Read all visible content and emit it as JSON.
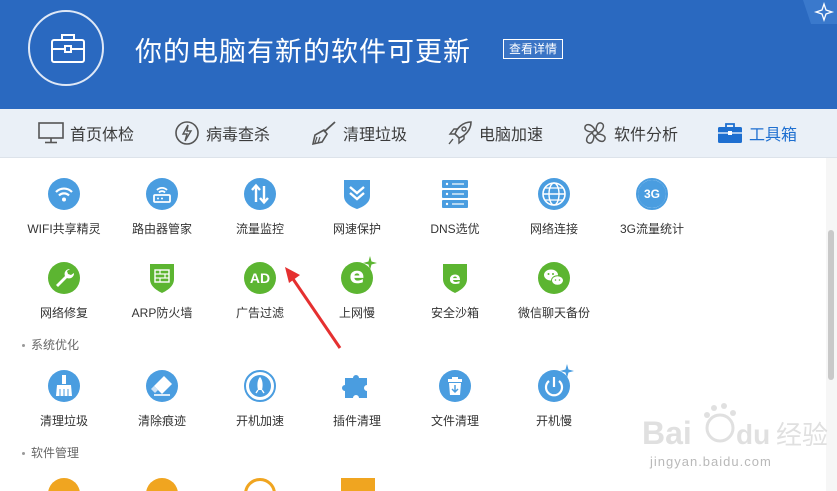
{
  "header": {
    "title": "你的电脑有新的软件可更新",
    "detail_button": "查看详情",
    "bg_color": "#2a69c0"
  },
  "nav": {
    "items": [
      {
        "label": "首页体检",
        "icon": "monitor-icon"
      },
      {
        "label": "病毒查杀",
        "icon": "lightning-shield-icon"
      },
      {
        "label": "清理垃圾",
        "icon": "broom-icon"
      },
      {
        "label": "电脑加速",
        "icon": "rocket-icon"
      },
      {
        "label": "软件分析",
        "icon": "fan-icon"
      },
      {
        "label": "工具箱",
        "icon": "toolbox-icon",
        "active": true
      }
    ],
    "active_color": "#1e6fd0"
  },
  "sections": {
    "network_row1": [
      {
        "label": "WIFI共享精灵",
        "icon": "wifi-icon",
        "color": "#4a9de0"
      },
      {
        "label": "路由器管家",
        "icon": "router-icon",
        "color": "#4a9de0"
      },
      {
        "label": "流量监控",
        "icon": "updown-arrows-icon",
        "color": "#4a9de0"
      },
      {
        "label": "网速保护",
        "icon": "shield-icon",
        "color": "#4a9de0"
      },
      {
        "label": "DNS选优",
        "icon": "server-icon",
        "color": "#4a9de0"
      },
      {
        "label": "网络连接",
        "icon": "globe-icon",
        "color": "#4a9de0"
      },
      {
        "label": "3G流量统计",
        "icon": "3g-icon",
        "color": "#4a9de0",
        "icon_text": "3G"
      }
    ],
    "network_row2": [
      {
        "label": "网络修复",
        "icon": "wrench-icon",
        "color": "#5cb531"
      },
      {
        "label": "ARP防火墙",
        "icon": "firewall-icon",
        "color": "#5cb531"
      },
      {
        "label": "广告过滤",
        "icon": "ad-icon",
        "color": "#5cb531",
        "icon_text": "AD"
      },
      {
        "label": "上网慢",
        "icon": "ie-icon",
        "color": "#5cb531",
        "icon_text": "e"
      },
      {
        "label": "安全沙箱",
        "icon": "sandbox-icon",
        "color": "#5cb531",
        "icon_text": "e"
      },
      {
        "label": "微信聊天备份",
        "icon": "wechat-icon",
        "color": "#5cb531"
      }
    ],
    "system_title": "系统优化",
    "system_row": [
      {
        "label": "清理垃圾",
        "icon": "brush-icon",
        "color": "#4a9de0"
      },
      {
        "label": "清除痕迹",
        "icon": "eraser-icon",
        "color": "#4a9de0"
      },
      {
        "label": "开机加速",
        "icon": "boot-rocket-icon",
        "color": "#4a9de0"
      },
      {
        "label": "插件清理",
        "icon": "puzzle-icon",
        "color": "#4a9de0"
      },
      {
        "label": "文件清理",
        "icon": "trash-icon",
        "color": "#4a9de0"
      },
      {
        "label": "开机慢",
        "icon": "power-icon",
        "color": "#4a9de0"
      }
    ],
    "software_title": "软件管理"
  },
  "watermark": {
    "text": "jingyan.baidu.com",
    "logo_text": "Bai du 经验"
  }
}
